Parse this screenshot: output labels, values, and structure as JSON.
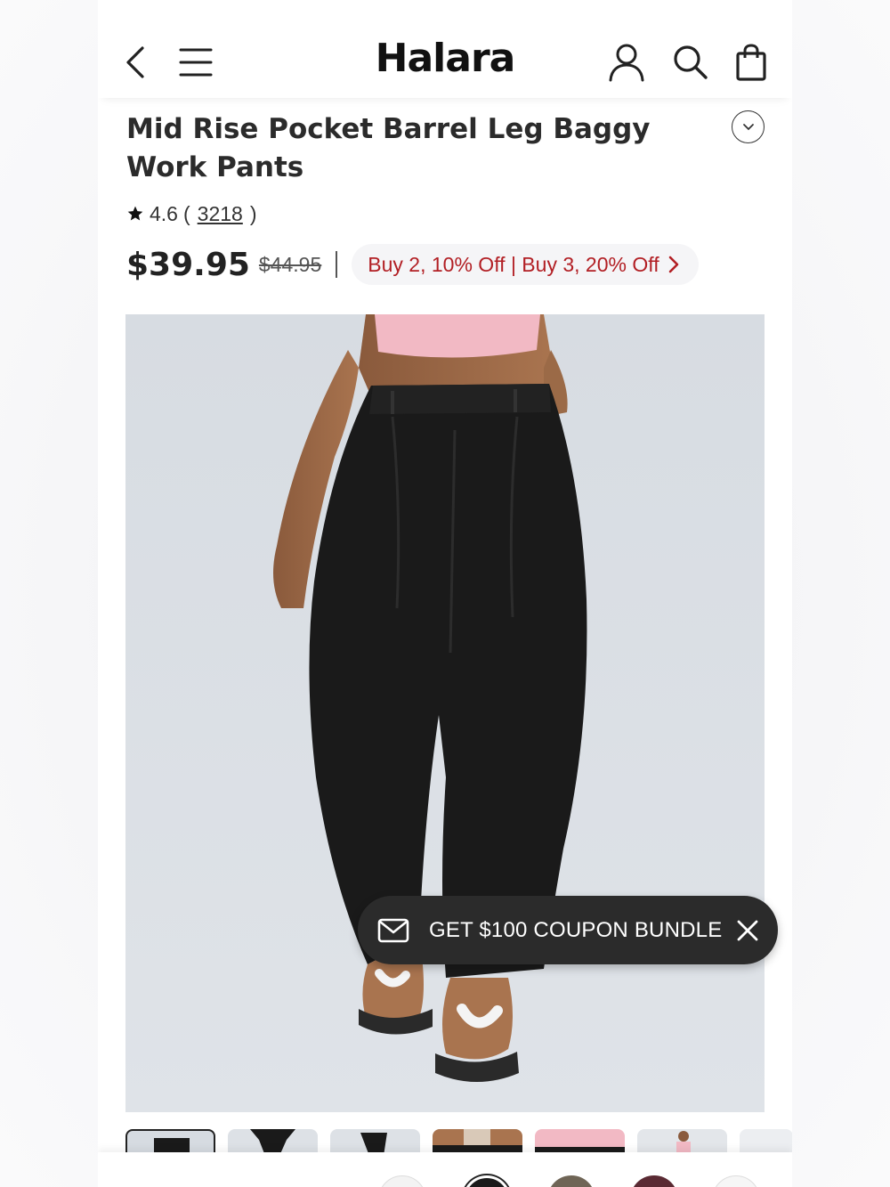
{
  "header": {
    "logo": "Halara",
    "icons": [
      "back-chevron-icon",
      "menu-icon",
      "account-icon",
      "search-icon",
      "shopping-bag-icon"
    ]
  },
  "product": {
    "title": "Mid Rise Pocket Barrel Leg Baggy Work Pants",
    "rating": "4.6",
    "rating_open": "(",
    "review_count": "3218",
    "rating_close": ")",
    "price": "$39.95",
    "original_price": "$44.95",
    "promo": "Buy 2, 10% Off | Buy 3, 20% Off"
  },
  "coupon_banner": {
    "label": "GET $100 COUPON BUNDLE"
  },
  "colors": {
    "promo_text": "#b21f24",
    "banner_bg": "#2b2b2b",
    "pants": "#1a1a1a",
    "image_bg": "#d8dde3"
  }
}
